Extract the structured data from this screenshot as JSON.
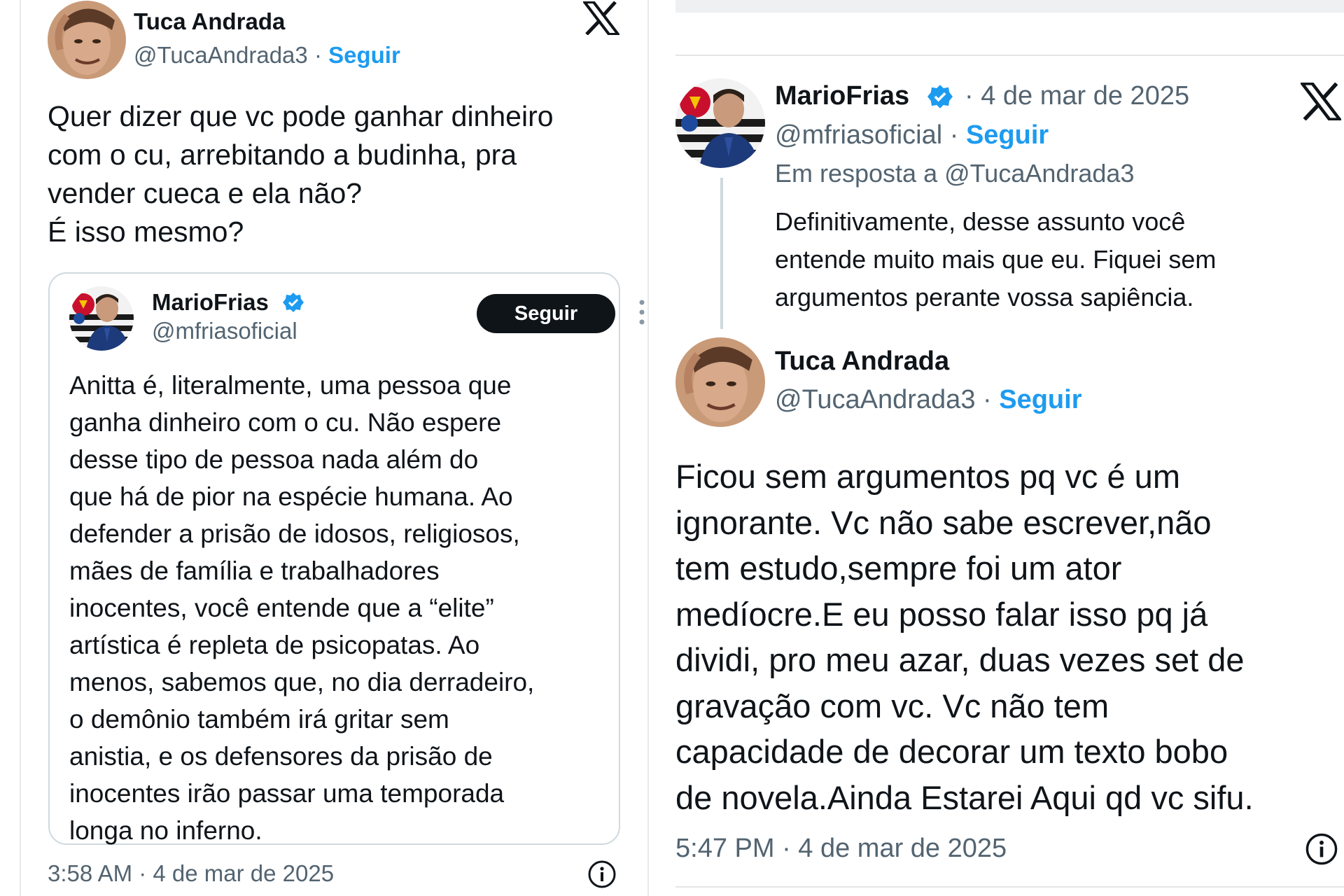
{
  "left_tweet": {
    "author": {
      "name": "Tuca Andrada",
      "handle": "@TucaAndrada3",
      "separator": "·",
      "follow_label": "Seguir"
    },
    "text_lines": [
      "Quer dizer que vc pode ganhar dinheiro",
      "com o cu, arrebitando a budinha, pra",
      "vender cueca e ela não?",
      "É  isso mesmo?"
    ],
    "quoted": {
      "name": "MarioFrias",
      "handle": "@mfriasoficial",
      "follow_button": "Seguir",
      "text_lines": [
        "Anitta é, literalmente, uma pessoa que",
        "ganha dinheiro com o cu. Não espere",
        "desse tipo de pessoa nada além do",
        "que há de pior na espécie humana. Ao",
        "defender a prisão de idosos, religiosos,",
        "mães de família e trabalhadores",
        "inocentes, você entende que a “elite”",
        "artística é repleta de psicopatas. Ao",
        "menos, sabemos que, no dia derradeiro,",
        "o demônio também irá gritar sem",
        "anistia, e os defensores da prisão de",
        "inocentes irão passar uma temporada",
        "longa no inferno."
      ]
    },
    "timestamp": "3:58 AM · 4 de mar de 2025"
  },
  "right_tweet": {
    "reply": {
      "name": "MarioFrias",
      "date": "4 de mar de 2025",
      "separator": "·",
      "handle": "@mfriasoficial",
      "follow_label": "Seguir",
      "in_reply_to": "Em resposta a @TucaAndrada3",
      "text_lines": [
        "Definitivamente, desse assunto você",
        "entende muito mais que eu. Fiquei sem",
        "argumentos perante vossa sapiência."
      ]
    },
    "response": {
      "name": "Tuca Andrada",
      "handle": "@TucaAndrada3",
      "separator": "·",
      "follow_label": "Seguir",
      "text_lines": [
        "Ficou sem argumentos pq vc é um",
        "ignorante. Vc não sabe escrever,não",
        "tem estudo,sempre foi um ator",
        "medíocre.E eu posso falar isso pq já",
        "dividi, pro meu azar, duas vezes set de",
        "gravação com vc. Vc não tem",
        "capacidade de decorar um texto bobo",
        "de novela.Ainda Estarei Aqui qd vc sifu."
      ],
      "timestamp": "5:47 PM · 4 de mar de 2025"
    }
  },
  "icons": {
    "x_logo": "x-logo-icon",
    "verified": "verified-badge-icon",
    "more": "more-dots-icon",
    "info": "info-icon"
  },
  "colors": {
    "accent_blue": "#1d9bf0",
    "text_primary": "#0f1419",
    "text_secondary": "#536471",
    "border": "#cfd9de",
    "follow_button_bg": "#0f1419"
  }
}
